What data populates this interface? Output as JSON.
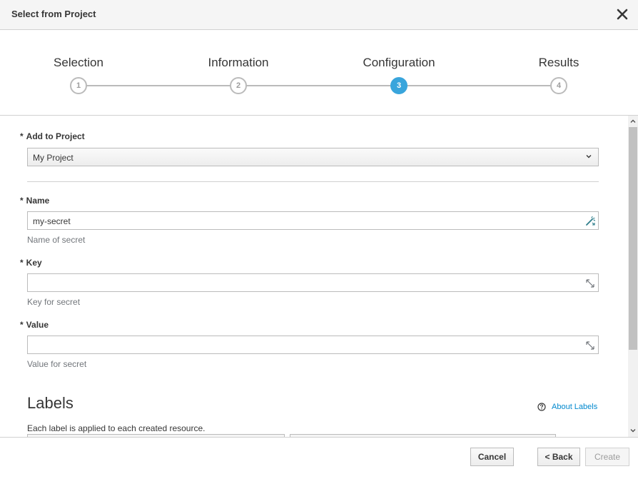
{
  "header": {
    "title": "Select from Project"
  },
  "wizard": {
    "steps": [
      {
        "label": "Selection",
        "number": "1",
        "active": false
      },
      {
        "label": "Information",
        "number": "2",
        "active": false
      },
      {
        "label": "Configuration",
        "number": "3",
        "active": true
      },
      {
        "label": "Results",
        "number": "4",
        "active": false
      }
    ]
  },
  "form": {
    "project": {
      "label": "Add to Project",
      "required_mark": "*",
      "value": "My Project"
    },
    "name": {
      "label": "Name",
      "required_mark": "*",
      "value": "my-secret",
      "help": "Name of secret"
    },
    "key": {
      "label": "Key",
      "required_mark": "*",
      "value": "",
      "help": "Key for secret"
    },
    "value": {
      "label": "Value",
      "required_mark": "*",
      "value": "",
      "help": "Value for secret"
    }
  },
  "labels": {
    "heading": "Labels",
    "about_link": "About Labels",
    "help": "Each label is applied to each created resource."
  },
  "footer": {
    "cancel": "Cancel",
    "back": "< Back",
    "create": "Create"
  },
  "colors": {
    "accent": "#39a5dc",
    "link": "#0088ce",
    "border": "#bbbbbb"
  },
  "icons": [
    "close-icon",
    "chevron-down-icon",
    "magic-wand-icon",
    "expand-icon",
    "question-circle-icon"
  ]
}
